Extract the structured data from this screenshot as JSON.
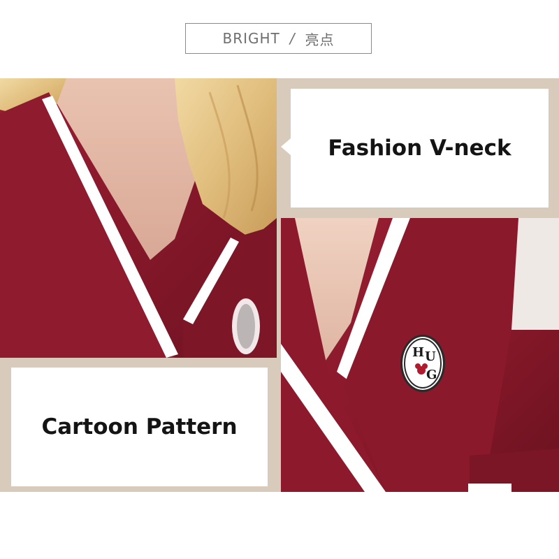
{
  "header": {
    "english": "BRIGHT",
    "separator": "/",
    "chinese": "亮点"
  },
  "features": [
    {
      "label": "Fashion V-neck"
    },
    {
      "label": "Cartoon Pattern"
    }
  ],
  "badge": {
    "letters": [
      "H",
      "U",
      "G"
    ]
  },
  "colors": {
    "robe": "#8c1a2c",
    "frame": "#d8cbbb",
    "trim": "#ffffff",
    "text": "#141414"
  }
}
